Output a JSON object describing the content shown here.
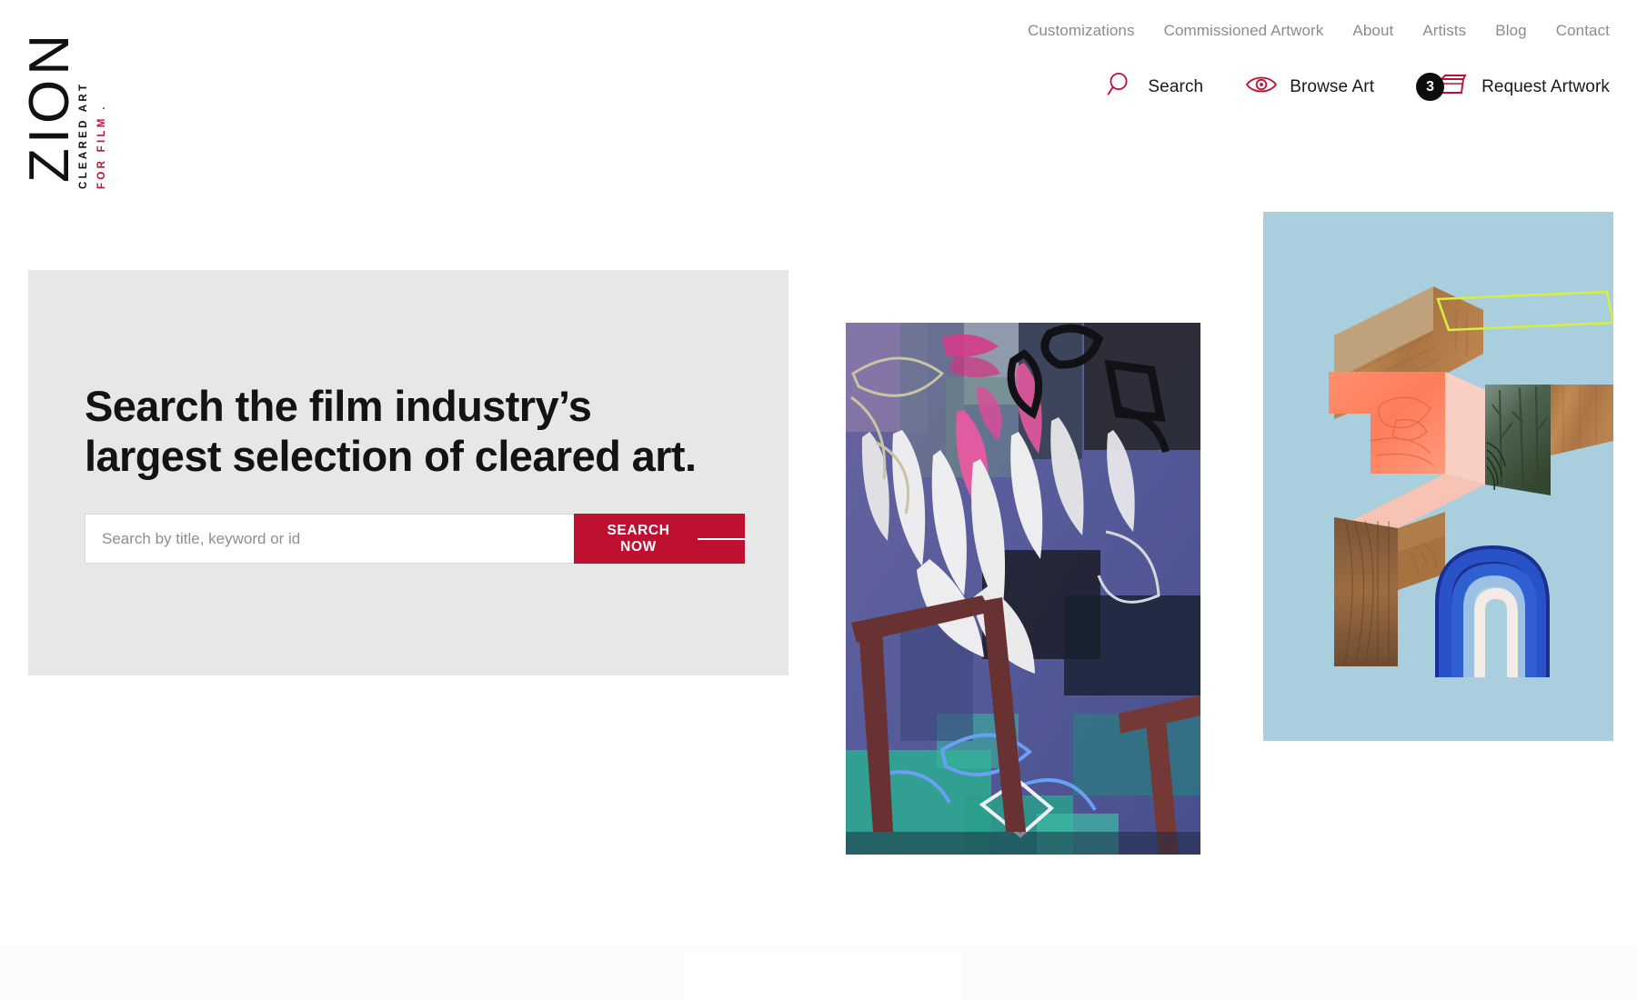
{
  "brand": {
    "mark": "ZION",
    "tagline_primary": "CLEARED ART",
    "tagline_secondary": "FOR FILM .",
    "accent_color": "#be1031",
    "ink_color": "#111111"
  },
  "nav_top": {
    "items": [
      {
        "label": "Customizations"
      },
      {
        "label": "Commissioned Artwork"
      },
      {
        "label": "About"
      },
      {
        "label": "Artists"
      },
      {
        "label": "Blog"
      },
      {
        "label": "Contact"
      }
    ],
    "link_color": "#8c8c8c"
  },
  "nav_actions": {
    "items": [
      {
        "label": "Search",
        "icon": "search-icon"
      },
      {
        "label": "Browse Art",
        "icon": "eye-icon"
      },
      {
        "label": "Request Artwork",
        "icon": "basket-icon",
        "badge": "3"
      }
    ]
  },
  "hero": {
    "headline_line1": "Search the film industry’s",
    "headline_line2": "largest selection of cleared art.",
    "panel_color": "#e7e7e7",
    "search": {
      "placeholder": "Search by title, keyword or id",
      "value": "",
      "button_label": "SEARCH NOW",
      "button_color": "#be1031"
    }
  },
  "artworks": [
    {
      "name": "abstract-painting",
      "description": "Abstract expressionist painting, blue and pink palette with white brushstrokes and black outlines",
      "palette": [
        "#5b5f9e",
        "#e8509b",
        "#ffffff",
        "#2fb89a",
        "#141414",
        "#7d3330"
      ]
    },
    {
      "name": "isometric-collage",
      "description": "Isometric digital collage with wood grain, coral form, forest photo, blue arc on pale blue ground",
      "palette": [
        "#a8cede",
        "#b07a45",
        "#ff8a65",
        "#f5c4b8",
        "#4a6b53",
        "#1f3f9e",
        "#d4ef3a"
      ]
    }
  ]
}
